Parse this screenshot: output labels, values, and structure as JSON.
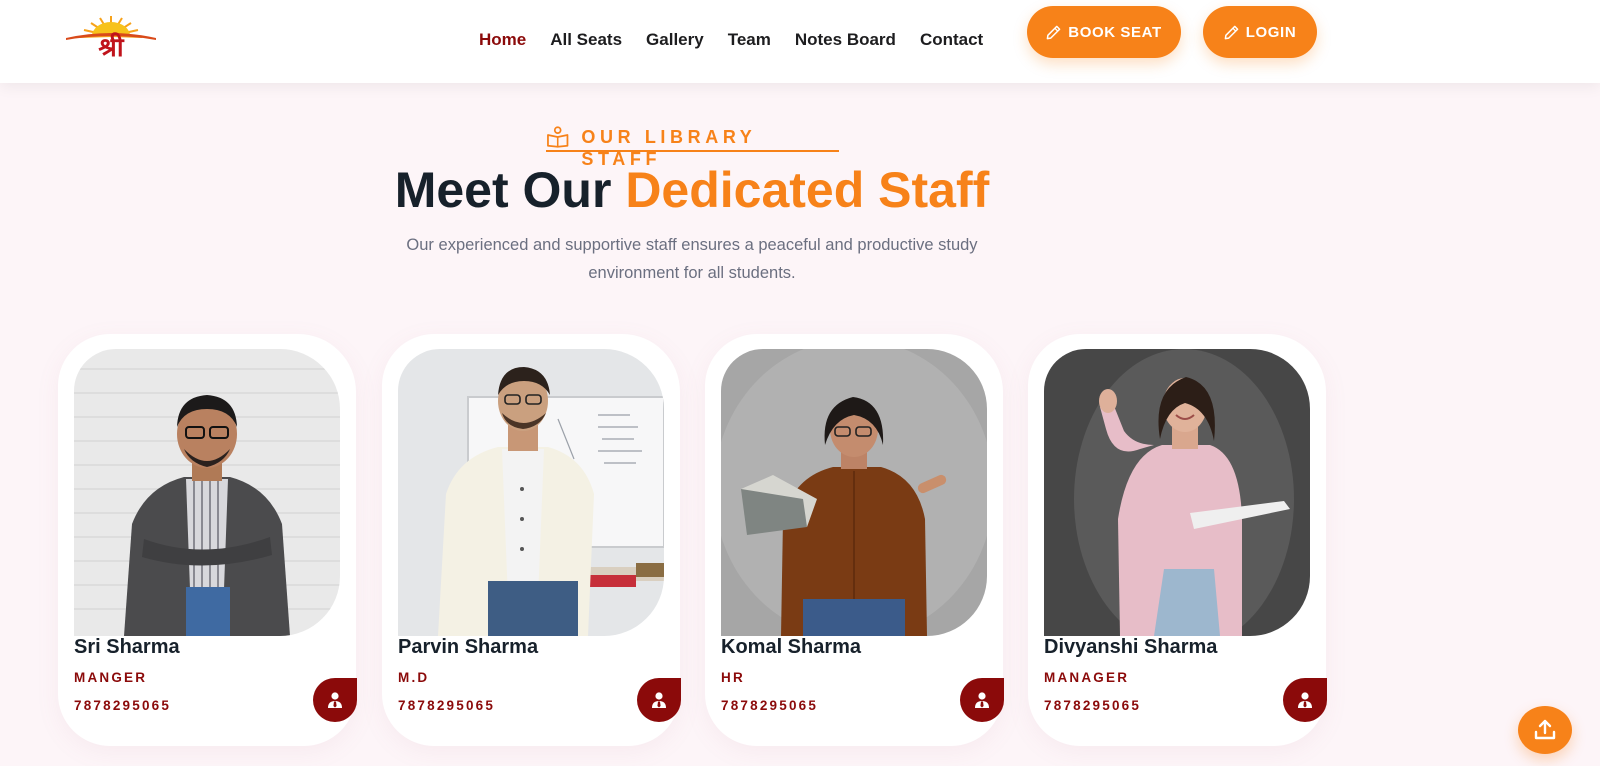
{
  "header": {
    "logo_text": "श्री",
    "nav": [
      {
        "label": "Home",
        "active": true
      },
      {
        "label": "All Seats",
        "active": false
      },
      {
        "label": "Gallery",
        "active": false
      },
      {
        "label": "Team",
        "active": false
      },
      {
        "label": "Notes Board",
        "active": false
      },
      {
        "label": "Contact",
        "active": false
      }
    ],
    "book_seat_label": "BOOK SEAT",
    "login_label": "LOGIN"
  },
  "section": {
    "eyebrow": "OUR LIBRARY STAFF",
    "title_part1": "Meet Our ",
    "title_accent": "Dedicated Staff",
    "subtitle_line1": "Our experienced and supportive staff ensures a peaceful and productive study",
    "subtitle_line2": "environment for all students."
  },
  "staff": [
    {
      "name": "Sri Sharma",
      "role": "MANGER",
      "phone": "7878295065"
    },
    {
      "name": "Parvin Sharma",
      "role": "M.D",
      "phone": "7878295065"
    },
    {
      "name": "Komal Sharma",
      "role": "HR",
      "phone": "7878295065"
    },
    {
      "name": "Divyanshi Sharma",
      "role": "MANAGER",
      "phone": "7878295065"
    }
  ],
  "colors": {
    "accent": "#f78219",
    "brand_dark_red": "#8b0a0a",
    "heading": "#17212b",
    "page_bg": "#fdf5f8"
  },
  "icons": {
    "eyebrow": "book-reader-icon",
    "button": "pencil-icon",
    "badge": "user-tie-icon",
    "scroll_top": "upload-arrow-icon"
  }
}
